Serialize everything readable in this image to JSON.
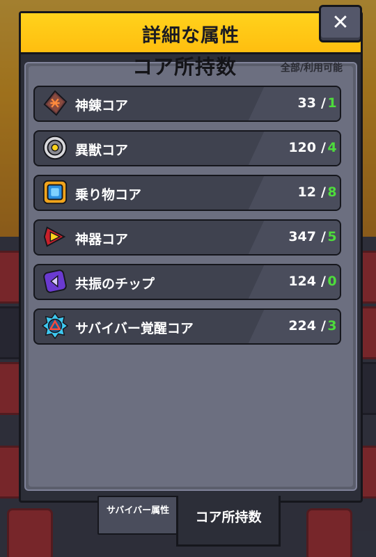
{
  "dialog": {
    "title": "詳細な属性",
    "close_label": "✕"
  },
  "section": {
    "title": "コア所持数",
    "subtitle": "全部/利用可能"
  },
  "cores": [
    {
      "name": "神錬コア",
      "total": "33",
      "separator": "/",
      "available": "1",
      "icon": "rune-stone-icon"
    },
    {
      "name": "異獣コア",
      "total": "120",
      "separator": "/",
      "available": "4",
      "icon": "beast-eye-icon"
    },
    {
      "name": "乗り物コア",
      "total": "12",
      "separator": "/",
      "available": "8",
      "icon": "vehicle-core-icon"
    },
    {
      "name": "神器コア",
      "total": "347",
      "separator": "/",
      "available": "5",
      "icon": "artifact-core-icon"
    },
    {
      "name": "共振のチップ",
      "total": "124",
      "separator": "/",
      "available": "0",
      "icon": "resonance-chip-icon"
    },
    {
      "name": "サバイバー覚醒コア",
      "total": "224",
      "separator": "/",
      "available": "3",
      "icon": "awakening-core-icon"
    }
  ],
  "tabs": [
    {
      "label": "サバイバー属性",
      "active": false
    },
    {
      "label": "コア所持数",
      "active": true
    }
  ],
  "colors": {
    "header": "#ffc414",
    "available_text": "#4edc3c",
    "row_bg": "#3f424f"
  }
}
